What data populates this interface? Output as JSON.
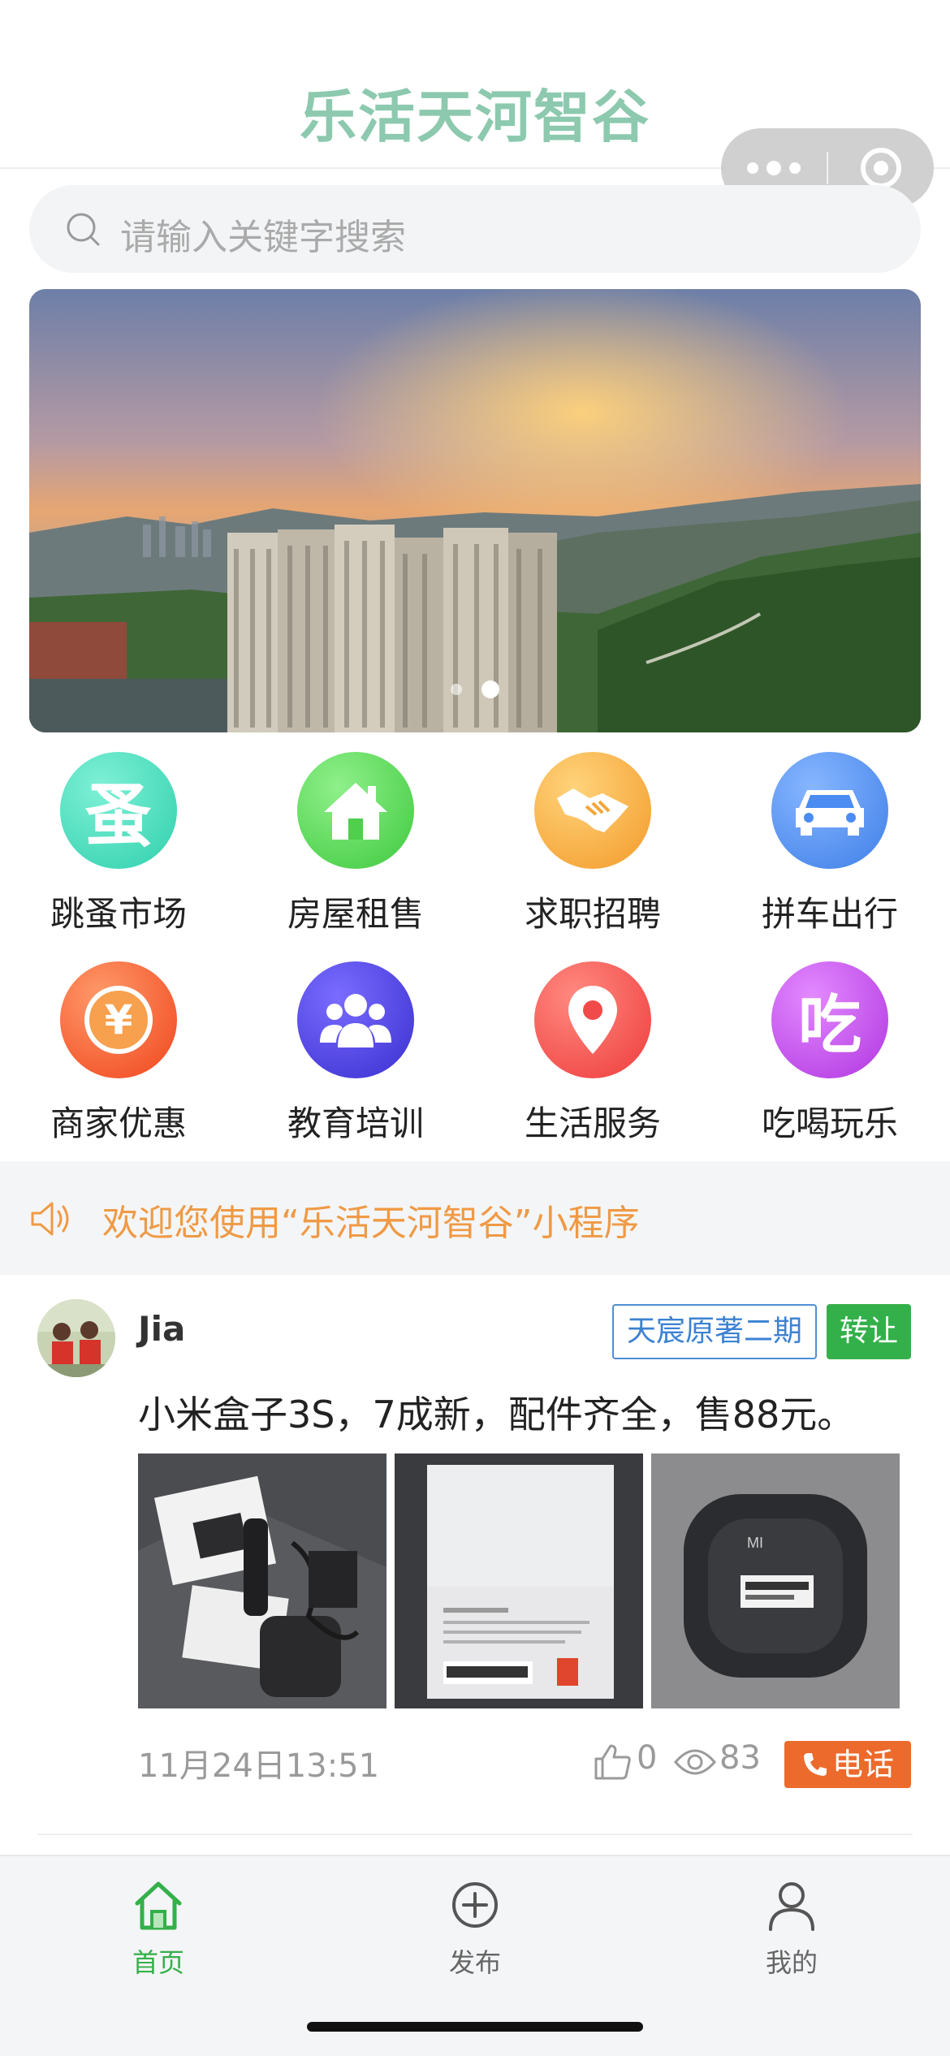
{
  "header": {
    "title": "乐活天河智谷"
  },
  "search": {
    "placeholder": "请输入关键字搜索"
  },
  "banner": {
    "slide_count": 2,
    "active_slide": 2
  },
  "categories": [
    {
      "label": "跳蚤市场",
      "icon": "flea-market-icon",
      "glyph": "蚤",
      "color": "#3fd9b5"
    },
    {
      "label": "房屋租售",
      "icon": "house-icon",
      "color": "#52d34f"
    },
    {
      "label": "求职招聘",
      "icon": "handshake-icon",
      "color": "#f6a93a"
    },
    {
      "label": "拼车出行",
      "icon": "car-icon",
      "color": "#4b8cf3"
    },
    {
      "label": "商家优惠",
      "icon": "yen-coin-icon",
      "glyph": "¥",
      "color": "#f4572a"
    },
    {
      "label": "教育培训",
      "icon": "people-icon",
      "color": "#4b3fd9"
    },
    {
      "label": "生活服务",
      "icon": "location-pin-icon",
      "color": "#f24a4a"
    },
    {
      "label": "吃喝玩乐",
      "icon": "eat-icon",
      "glyph": "吃",
      "color": "#bb44e6"
    }
  ],
  "notice": {
    "text": "欢迎您使用“乐活天河智谷”小程序",
    "color": "#ef9a45"
  },
  "post": {
    "username": "Jia",
    "area_tag": "天宸原著二期",
    "type_tag": "转让",
    "text": "小米盒子3S，7成新，配件齐全，售88元。",
    "time": "11月24日13:51",
    "likes": "0",
    "views": "83",
    "call_label": "电话",
    "photo_count": 3
  },
  "tabbar": {
    "items": [
      {
        "label": "首页",
        "icon": "home-icon",
        "active": true
      },
      {
        "label": "发布",
        "icon": "plus-circle-icon",
        "active": false
      },
      {
        "label": "我的",
        "icon": "user-icon",
        "active": false
      }
    ],
    "active_color": "#34b04a"
  }
}
